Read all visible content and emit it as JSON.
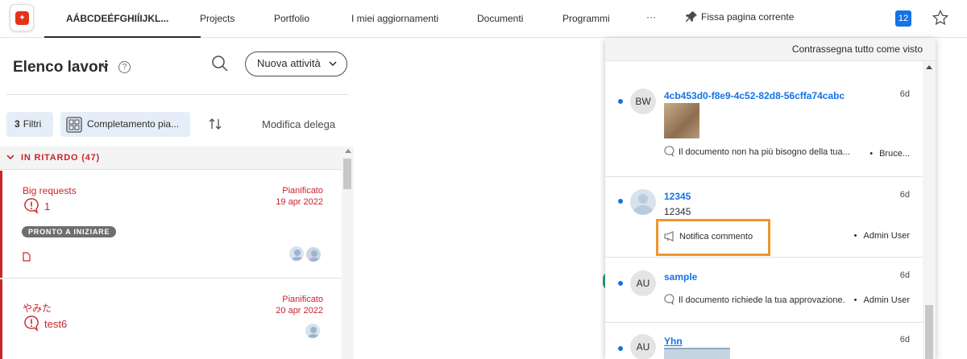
{
  "nav": {
    "active_tab": "AÁBCDEÉFGHIÍIJKL...",
    "items": [
      "Projects",
      "Portfolio",
      "I miei aggiornamenti",
      "Documenti",
      "Programmi",
      "···"
    ],
    "pin_label": "Fissa pagina corrente",
    "notification_count": "12"
  },
  "worklist": {
    "title": "Elenco lavori",
    "help": "?",
    "new_task_label": "Nuova attività",
    "filter_count": "3",
    "filter_label": "Filtri",
    "group_label": "Completamento pia...",
    "delegate_label": "Modifica delega",
    "section_label": "IN RITARDO (47)",
    "cards": [
      {
        "name": "Big requests",
        "plan_label": "Pianificato",
        "plan_date": "19 apr 2022",
        "comment_count": "1",
        "status": "PRONTO A INIZIARE"
      },
      {
        "name": "やみた",
        "plan_label": "Pianificato",
        "plan_date": "20 apr 2022",
        "comment_count": "test6"
      }
    ]
  },
  "notifications": {
    "mark_all_label": "Contrassegna tutto come visto",
    "items": [
      {
        "avatar": "BW",
        "title": "4cb453d0-f8e9-4c52-82d8-56cffa74cabc",
        "age": "6d",
        "message": "Il documento non ha più bisogno della tua...",
        "by": "Bruce..."
      },
      {
        "avatar": "",
        "title": "12345",
        "subtitle": "12345",
        "age": "6d",
        "message": "Notifica commento",
        "by": "Admin User"
      },
      {
        "avatar": "AU",
        "title": "sample",
        "age": "6d",
        "message": "Il documento richiede la tua approvazione.",
        "by": "Admin User"
      },
      {
        "avatar": "AU",
        "title": "Yhn",
        "age": "6d"
      }
    ]
  },
  "colors": {
    "accent": "#1473e6",
    "late": "#c9252d",
    "highlight": "#f0952e"
  }
}
